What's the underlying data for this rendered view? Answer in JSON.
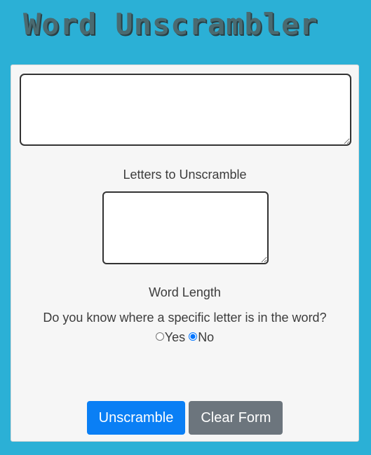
{
  "header": {
    "title": "Word Unscrambler"
  },
  "form": {
    "phrase_input_value": "",
    "letters_label": "Letters to Unscramble",
    "letters_input_value": "",
    "word_length_label": "Word Length",
    "position_question": "Do you know where a specific letter is in the word?",
    "yes_label": "Yes",
    "no_label": "No",
    "selected_option": "No"
  },
  "buttons": {
    "unscramble_label": "Unscramble",
    "clear_label": "Clear Form"
  },
  "colors": {
    "background": "#2bb0d6",
    "panel": "#f6f6f6",
    "primary_button": "#0a7ff5",
    "secondary_button": "#6c757d",
    "title": "#4a6a70"
  }
}
